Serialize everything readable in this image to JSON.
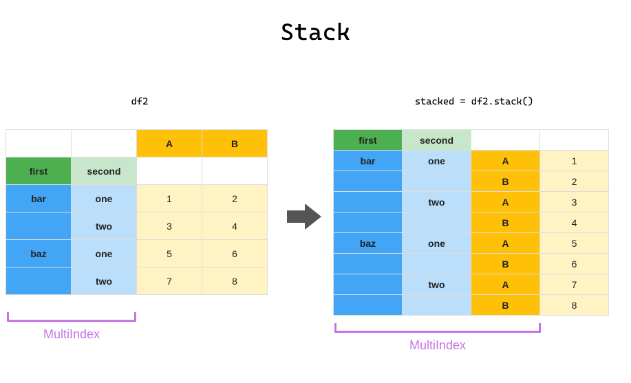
{
  "title": "Stack",
  "captions": {
    "left": "df2",
    "right": "stacked = df2.stack()"
  },
  "multiindex_label": "MultiIndex",
  "left_table": {
    "col_headers": {
      "A": "A",
      "B": "B"
    },
    "index_names": {
      "first": "first",
      "second": "second"
    },
    "rows": [
      {
        "first": "bar",
        "second": "one",
        "A": "1",
        "B": "2"
      },
      {
        "first": "",
        "second": "two",
        "A": "3",
        "B": "4"
      },
      {
        "first": "baz",
        "second": "one",
        "A": "5",
        "B": "6"
      },
      {
        "first": "",
        "second": "two",
        "A": "7",
        "B": "8"
      }
    ]
  },
  "right_table": {
    "index_names": {
      "first": "first",
      "second": "second"
    },
    "rows": [
      {
        "first": "bar",
        "second": "one",
        "col": "A",
        "val": "1"
      },
      {
        "first": "",
        "second": "",
        "col": "B",
        "val": "2"
      },
      {
        "first": "",
        "second": "two",
        "col": "A",
        "val": "3"
      },
      {
        "first": "",
        "second": "",
        "col": "B",
        "val": "4"
      },
      {
        "first": "baz",
        "second": "one",
        "col": "A",
        "val": "5"
      },
      {
        "first": "",
        "second": "",
        "col": "B",
        "val": "6"
      },
      {
        "first": "",
        "second": "two",
        "col": "A",
        "val": "7"
      },
      {
        "first": "",
        "second": "",
        "col": "B",
        "val": "8"
      }
    ]
  }
}
